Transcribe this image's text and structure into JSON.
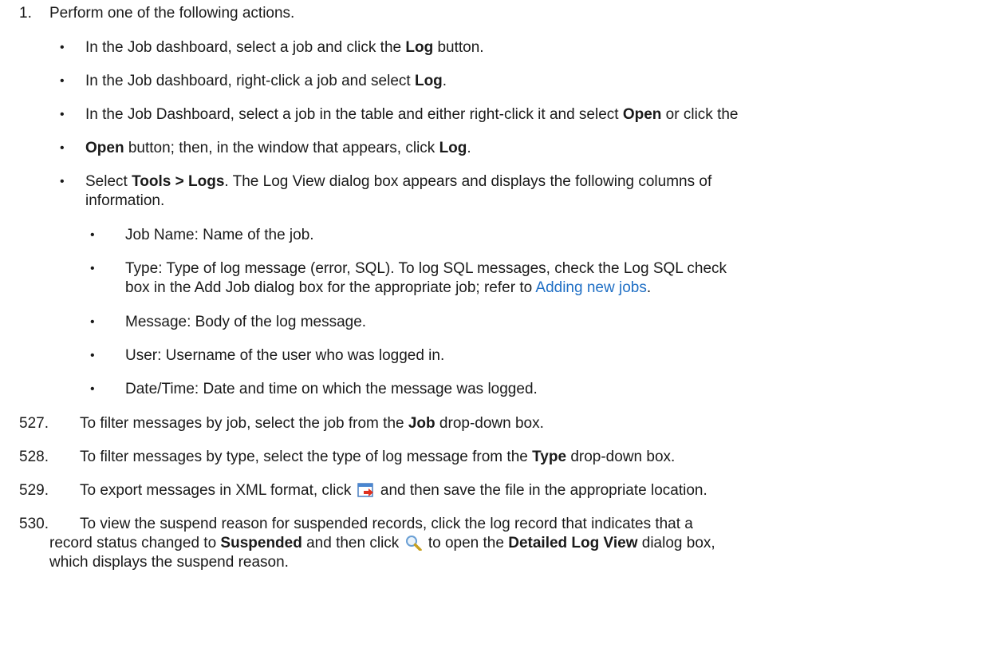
{
  "step1": {
    "num": "1.",
    "text": "Perform one of the following actions."
  },
  "bullets": [
    {
      "pre": "In the Job dashboard, select a job and click the ",
      "bold": "Log",
      "post": " button."
    },
    {
      "pre": "In the Job dashboard, right-click a job and select ",
      "bold": "Log",
      "post": "."
    },
    {
      "pre": "In the Job Dashboard, select a job in the table and either right-click it and select ",
      "bold": "Open",
      "post": " or click the"
    },
    {
      "bold1": "Open",
      "mid": " button; then, in the window that appears, click ",
      "bold2": "Log",
      "post": "."
    },
    {
      "pre": "Select ",
      "bold": "Tools > Logs",
      "post": ". The Log View dialog box appears and displays the following columns of",
      "cont": "information."
    }
  ],
  "columns": [
    {
      "text": "Job Name: Name of the job."
    },
    {
      "text": "Type: Type of log message (error, SQL). To log SQL messages, check the Log SQL check",
      "cont_pre": "box in the Add Job dialog box for the appropriate job; refer to ",
      "link": "Adding new jobs",
      "cont_post": "."
    },
    {
      "text": "Message: Body of the log message."
    },
    {
      "text": "User: Username of the user who was logged in."
    },
    {
      "text": "Date/Time: Date and time on which the message was logged."
    }
  ],
  "steps": [
    {
      "num": "527.",
      "pre": "To filter messages by job, select the job from the ",
      "bold": "Job",
      "post": " drop-down box."
    },
    {
      "num": "528.",
      "pre": "To filter messages by type, select the type of log message from the ",
      "bold": "Type",
      "post": " drop-down box."
    },
    {
      "num": "529.",
      "pre": "To export messages in XML format, click ",
      "icon": "export-icon",
      "post": "  and then save the file in the appropriate location."
    },
    {
      "num": "530.",
      "pre": "To view the suspend reason for suspended records, click the log record that indicates that a",
      "l2_pre": "record status changed to ",
      "l2_bold": "Suspended",
      "l2_mid": " and then click ",
      "l2_icon": "magnifier-icon",
      "l2_mid2": "  to open the ",
      "l2_bold2": "Detailed Log View",
      "l2_post": " dialog box,",
      "l3": "which  displays the suspend reason."
    }
  ],
  "bullet_glyph": "•"
}
